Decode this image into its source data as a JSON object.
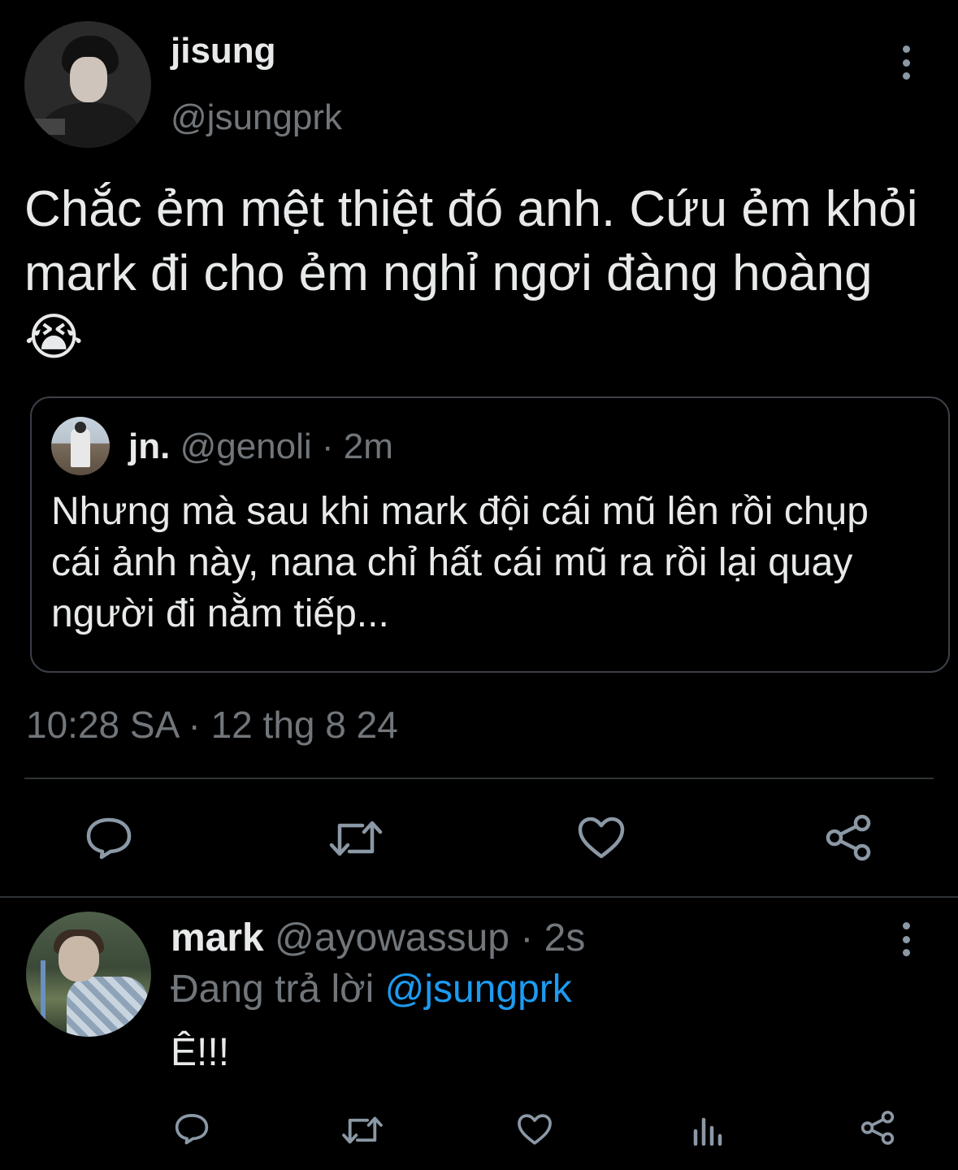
{
  "colors": {
    "background": "#000000",
    "text": "#e7e9ea",
    "muted": "#71767b",
    "accent": "#1d9bf0",
    "border": "#2f3336"
  },
  "main_tweet": {
    "display_name": "jisung",
    "handle": "@jsungprk",
    "text": "Chắc ẻm mệt thiệt đó anh. Cứu ẻm khỏi mark đi cho ẻm nghỉ ngơi đàng hoàng",
    "emoji": "😭",
    "timestamp": "10:28 SA · 12 thg 8 24",
    "quote": {
      "display_name": "jn.",
      "handle": "@genoli",
      "time": "· 2m",
      "text": "Nhưng mà sau khi mark đội cái mũ lên rồi chụp cái ảnh này, nana chỉ hất cái mũ ra rồi lại quay người đi nằm tiếp..."
    },
    "actions": [
      "reply-icon",
      "retweet-icon",
      "like-icon",
      "share-icon"
    ]
  },
  "reply_tweet": {
    "display_name": "mark",
    "handle": "@ayowassup",
    "time": "· 2s",
    "replying_prefix": "Đang trả lời",
    "replying_mention": "@jsungprk",
    "text": "Ê!!!",
    "actions": [
      "reply-icon",
      "retweet-icon",
      "like-icon",
      "views-icon",
      "share-icon"
    ]
  }
}
